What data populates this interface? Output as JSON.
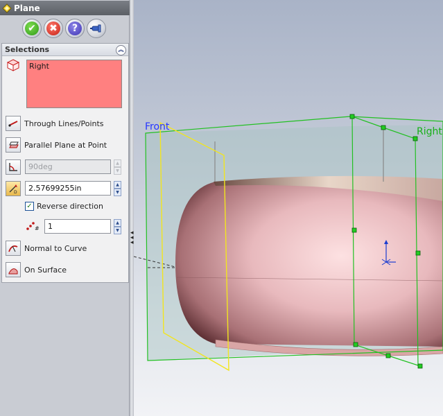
{
  "property_manager": {
    "title": "Plane",
    "actions": {
      "ok_icon": "check-icon",
      "cancel_icon": "x-icon",
      "help_icon": "question-icon",
      "pin_icon": "push-pin-icon"
    },
    "selections": {
      "header": "Selections",
      "references": [
        "Right"
      ],
      "options": [
        {
          "label": "Through Lines/Points",
          "icon": "through-lines-points-icon"
        },
        {
          "label": "Parallel Plane at Point",
          "icon": "parallel-plane-icon"
        }
      ],
      "angle_value": "90deg",
      "distance_value": "2.57699255in",
      "reverse_direction": {
        "label": "Reverse direction",
        "checked": true
      },
      "instances_value": "1",
      "options_lower": [
        {
          "label": "Normal to Curve",
          "icon": "normal-to-curve-icon"
        },
        {
          "label": "On Surface",
          "icon": "on-surface-icon"
        }
      ]
    }
  },
  "viewport": {
    "plane_labels": {
      "front": "Front",
      "right": "Right"
    },
    "colors": {
      "front_plane": "#2535ff",
      "right_plane": "#18b018",
      "selected_edge": "#f0e020"
    }
  }
}
